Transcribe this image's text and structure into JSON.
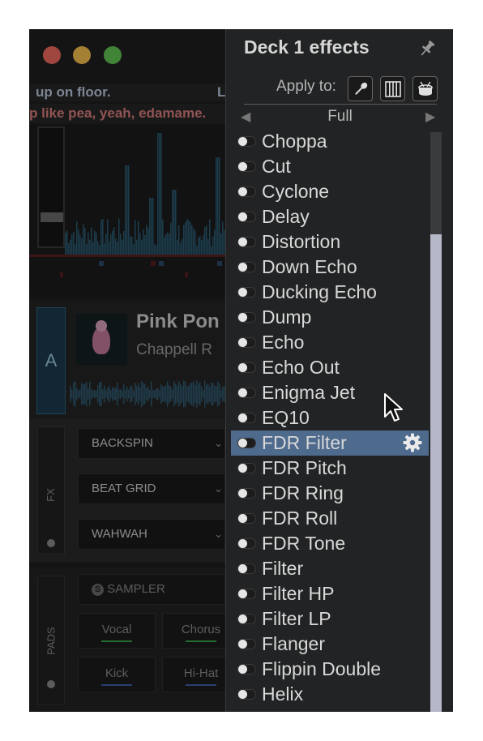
{
  "window": {
    "traffic_lights": {
      "close_color": "#ed6a5e",
      "minimize_color": "#f5bf4f",
      "zoom_color": "#61c554"
    }
  },
  "background_app": {
    "lyrics_line_1": "up  on floor.",
    "lyrics_line_1_right": "L",
    "lyrics_line_2": "p like pea, yeah, edamame. ",
    "deck_label": "A",
    "track_title": "Pink Pon",
    "track_artist": "Chappell R",
    "fx": {
      "label": "FX",
      "slots": [
        "BACKSPIN",
        "BEAT GRID",
        "WAHWAH"
      ]
    },
    "pads": {
      "label": "PADS",
      "mode": "SAMPLER",
      "mode_icon": "s-circle-icon",
      "buttons": [
        {
          "label": "Vocal",
          "color": "#3aa04a"
        },
        {
          "label": "Chorus",
          "color": "#3aa04a"
        },
        {
          "label": "Kick",
          "color": "#3e5ea8"
        },
        {
          "label": "Hi-Hat",
          "color": "#3e5ea8"
        }
      ]
    }
  },
  "effects_panel": {
    "title": "Deck 1 effects",
    "pin_icon": "pin-icon",
    "apply_to_label": "Apply to:",
    "apply_targets": [
      "microphone-icon",
      "keyboard-icon",
      "drum-icon"
    ],
    "preset": {
      "name": "Full",
      "prev_icon": "triangle-left-icon",
      "next_icon": "triangle-right-icon"
    },
    "accent_color": "#4e6a8d",
    "selected_effect": "FDR Filter",
    "effects": [
      "Choppa",
      "Cut",
      "Cyclone",
      "Delay",
      "Distortion",
      "Down Echo",
      "Ducking Echo",
      "Dump",
      "Echo",
      "Echo Out",
      "Enigma Jet",
      "EQ10",
      "FDR Filter",
      "FDR Pitch",
      "FDR Ring",
      "FDR Roll",
      "FDR Tone",
      "Filter",
      "Filter HP",
      "Filter LP",
      "Flanger",
      "Flippin Double",
      "Helix"
    ],
    "settings_icon": "gear-icon"
  }
}
